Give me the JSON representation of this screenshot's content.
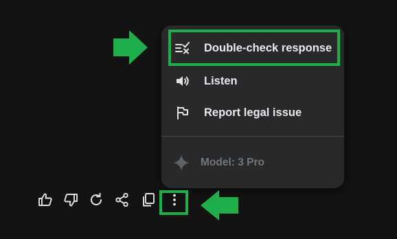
{
  "menu": {
    "items": [
      {
        "label": "Double-check response",
        "icon": "double-check-icon"
      },
      {
        "label": "Listen",
        "icon": "speaker-icon"
      },
      {
        "label": "Report legal issue",
        "icon": "flag-icon"
      }
    ],
    "model_label": "Model: 3 Pro",
    "model_icon": "sparkle-icon"
  },
  "toolbar": {
    "buttons": [
      {
        "icon": "thumbs-up-icon"
      },
      {
        "icon": "thumbs-down-icon"
      },
      {
        "icon": "regenerate-icon"
      },
      {
        "icon": "share-icon"
      },
      {
        "icon": "copy-icon"
      },
      {
        "icon": "more-options-icon"
      }
    ]
  },
  "colors": {
    "background": "#131314",
    "menu_background": "#28292a",
    "highlight": "#1fae4a",
    "text": "#e8eaed",
    "muted_text": "#74777a"
  }
}
